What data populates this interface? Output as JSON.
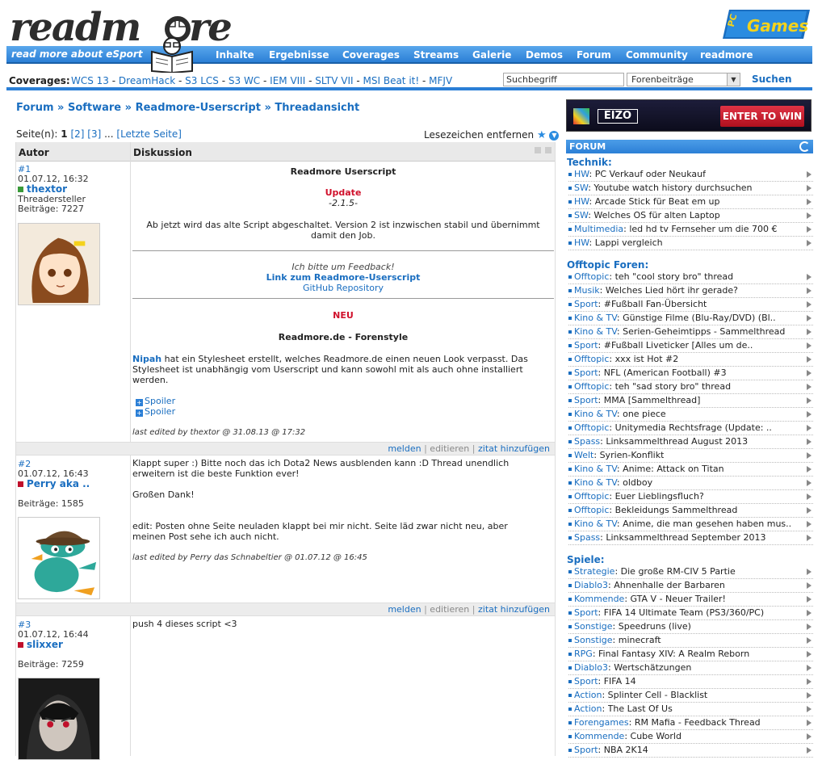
{
  "header": {
    "logo_text": "readm re",
    "tagline": "read more about eSport",
    "pcgames_logo": "PC Games",
    "nav": [
      "Inhalte",
      "Ergebnisse",
      "Coverages",
      "Streams",
      "Galerie",
      "Demos",
      "Forum",
      "Community",
      "readmore"
    ]
  },
  "coverages": {
    "label": "Coverages:",
    "links": [
      "WCS 13",
      "DreamHack",
      "S3 LCS",
      "S3 WC",
      "IEM VIII",
      "SLTV VII",
      "MSI Beat it!",
      "MFJV"
    ],
    "separator": " - "
  },
  "search": {
    "value": "Suchbegriff",
    "select_value": "Forenbeiträge",
    "button": "Suchen"
  },
  "breadcrumb": [
    "Forum",
    "Software",
    "Readmore-Userscript",
    "Threadansicht"
  ],
  "pagination": {
    "label": "Seite(n):",
    "current": "1",
    "pages": [
      "[2]",
      "[3]"
    ],
    "ellipsis": "...",
    "last": "[Letzte Seite]"
  },
  "bookmark": {
    "label": "Lesezeichen entfernen",
    "icons": [
      "star-icon",
      "arrow-down-icon"
    ]
  },
  "thread": {
    "col_author": "Autor",
    "col_discussion": "Diskussion",
    "posts": [
      {
        "id": "#1",
        "date": "01.07.12, 16:32",
        "user": "thextor",
        "status_color": "#3a9a3a",
        "role": "Threadersteller",
        "posts_label": "Beiträge: 7227",
        "title": "Readmore Userscript",
        "update_label": "Update",
        "version": "-2.1.5-",
        "body1": "Ab jetzt wird das alte Script abgeschaltet. Version 2 ist inzwischen stabil und übernimmt damit den Job.",
        "feedback": "Ich bitte um Feedback!",
        "link1": "Link zum Readmore-Userscript",
        "link2": "GitHub Repository",
        "neu_label": "NEU",
        "forenstyle": "Readmore.de - Forenstyle",
        "body2_name": "Nipah",
        "body2": " hat ein Stylesheet erstellt, welches Readmore.de einen neuen Look verpasst. Das Stylesheet ist unabhängig vom Userscript und kann sowohl mit als auch ohne installiert werden.",
        "spoilers": [
          "Spoiler",
          "Spoiler"
        ],
        "edited": "last edited by thextor @ 31.08.13 @ 17:32"
      },
      {
        "id": "#2",
        "date": "01.07.12, 16:43",
        "user": "Perry aka ..",
        "status_color": "#c0102b",
        "posts_label": "Beiträge: 1585",
        "body1": "Klappt super :) Bitte noch das ich Dota2 News ausblenden kann :D Thread unendlich erweitern ist die beste Funktion ever!",
        "body2": "Großen Dank!",
        "body3": "edit: Posten ohne Seite neuladen klappt bei mir nicht. Seite läd zwar nicht neu, aber meinen Post sehe ich auch nicht.",
        "edited": "last edited by Perry das Schnabeltier @ 01.07.12 @ 16:45"
      },
      {
        "id": "#3",
        "date": "01.07.12, 16:44",
        "user": "slixxer",
        "status_color": "#c0102b",
        "posts_label": "Beiträge: 7259",
        "body1": "push 4 dieses script <3"
      }
    ],
    "actions": {
      "report": "melden",
      "edit": "editieren",
      "quote": "zitat hinzufügen",
      "sep": "|"
    }
  },
  "sidebar": {
    "ad": {
      "logo": "EIZO",
      "button": "ENTER TO WIN"
    },
    "forum_title": "FORUM",
    "sections": [
      {
        "title": "Technik:",
        "items": [
          {
            "cat": "HW",
            "title": "PC Verkauf oder Neukauf"
          },
          {
            "cat": "SW",
            "title": "Youtube watch history durchsuchen"
          },
          {
            "cat": "HW",
            "title": "Arcade Stick für Beat em up"
          },
          {
            "cat": "SW",
            "title": "Welches OS für alten Laptop"
          },
          {
            "cat": "Multimedia",
            "title": "led hd tv Fernseher um die 700 €"
          },
          {
            "cat": "HW",
            "title": "Lappi vergleich"
          }
        ]
      },
      {
        "title": "Offtopic Foren:",
        "items": [
          {
            "cat": "Offtopic",
            "title": "teh \"cool story bro\" thread"
          },
          {
            "cat": "Musik",
            "title": "Welches Lied hört ihr gerade?"
          },
          {
            "cat": "Sport",
            "title": "#Fußball Fan-Übersicht"
          },
          {
            "cat": "Kino & TV",
            "title": "Günstige Filme (Blu-Ray/DVD) (Bl.."
          },
          {
            "cat": "Kino & TV",
            "title": "Serien-Geheimtipps - Sammelthread"
          },
          {
            "cat": "Sport",
            "title": "#Fußball Liveticker [Alles um de.."
          },
          {
            "cat": "Offtopic",
            "title": "xxx ist Hot #2"
          },
          {
            "cat": "Sport",
            "title": "NFL (American Football) #3"
          },
          {
            "cat": "Offtopic",
            "title": "teh \"sad story bro\" thread"
          },
          {
            "cat": "Sport",
            "title": "MMA [Sammelthread]"
          },
          {
            "cat": "Kino & TV",
            "title": "one piece"
          },
          {
            "cat": "Offtopic",
            "title": "Unitymedia Rechtsfrage (Update: .."
          },
          {
            "cat": "Spass",
            "title": "Linksammelthread August 2013"
          },
          {
            "cat": "Welt",
            "title": "Syrien-Konflikt"
          },
          {
            "cat": "Kino & TV",
            "title": "Anime: Attack on Titan"
          },
          {
            "cat": "Kino & TV",
            "title": "oldboy"
          },
          {
            "cat": "Offtopic",
            "title": "Euer Lieblingsfluch?"
          },
          {
            "cat": "Offtopic",
            "title": "Bekleidungs Sammelthread"
          },
          {
            "cat": "Kino & TV",
            "title": "Anime, die man gesehen haben mus.."
          },
          {
            "cat": "Spass",
            "title": "Linksammelthread September 2013"
          }
        ]
      },
      {
        "title": "Spiele:",
        "items": [
          {
            "cat": "Strategie",
            "title": "Die große RM-CIV 5 Partie"
          },
          {
            "cat": "Diablo3",
            "title": "Ahnenhalle der Barbaren"
          },
          {
            "cat": "Kommende",
            "title": "GTA V - Neuer Trailer!"
          },
          {
            "cat": "Sport",
            "title": "FIFA 14 Ultimate Team (PS3/360/PC)"
          },
          {
            "cat": "Sonstige",
            "title": "Speedruns (live)"
          },
          {
            "cat": "Sonstige",
            "title": "minecraft"
          },
          {
            "cat": "RPG",
            "title": "Final Fantasy XIV: A Realm Reborn"
          },
          {
            "cat": "Diablo3",
            "title": "Wertschätzungen"
          },
          {
            "cat": "Sport",
            "title": "FIFA 14"
          },
          {
            "cat": "Action",
            "title": "Splinter Cell - Blacklist"
          },
          {
            "cat": "Action",
            "title": "The Last Of Us"
          },
          {
            "cat": "Forengames",
            "title": "RM Mafia - Feedback Thread"
          },
          {
            "cat": "Kommende",
            "title": "Cube World"
          },
          {
            "cat": "Sport",
            "title": "NBA 2K14"
          }
        ]
      }
    ]
  }
}
